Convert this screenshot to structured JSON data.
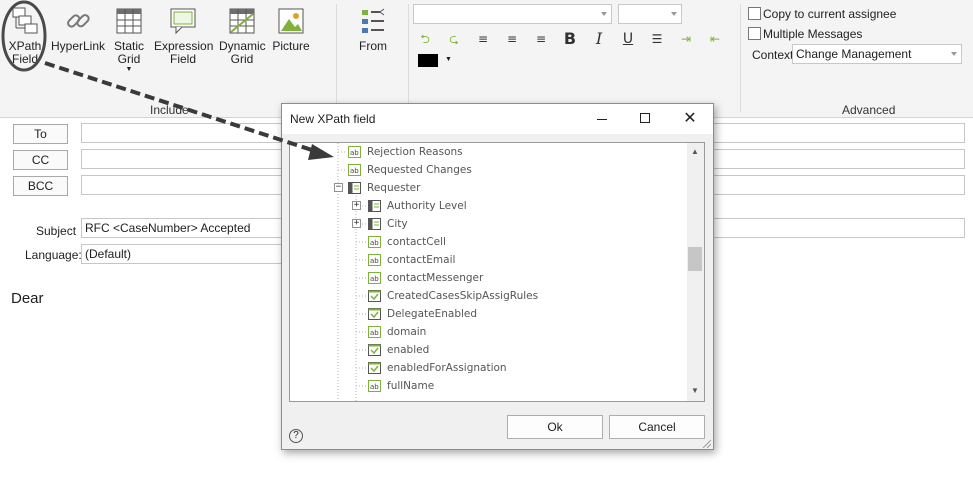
{
  "ribbon": {
    "insert_buttons": [
      {
        "label_line1": "XPath",
        "label_line2": "Field",
        "icon": "xpath-field-icon"
      },
      {
        "label_line1": "HyperLink",
        "label_line2": "",
        "icon": "hyperlink-icon"
      },
      {
        "label_line1": "Static",
        "label_line2": "Grid",
        "icon": "static-grid-icon"
      },
      {
        "label_line1": "Expression",
        "label_line2": "Field",
        "icon": "expression-field-icon"
      },
      {
        "label_line1": "Dynamic",
        "label_line2": "Grid",
        "icon": "dynamic-grid-icon"
      },
      {
        "label_line1": "Picture",
        "label_line2": "",
        "icon": "picture-icon"
      }
    ],
    "include_group_label": "Include",
    "from_label": "From",
    "font_combo_value": "",
    "size_combo_value": "",
    "font_color": "#000000",
    "advanced": {
      "copy_to_assignee_label": "Copy to current assignee",
      "copy_to_assignee_checked": false,
      "multiple_messages_label": "Multiple Messages",
      "multiple_messages_checked": false,
      "context_label": "Context",
      "context_value": "Change Management",
      "group_label": "Advanced"
    }
  },
  "email_form": {
    "to_label": "To",
    "cc_label": "CC",
    "bcc_label": "BCC",
    "to_value": "",
    "cc_value": "",
    "bcc_value": "",
    "subject_label": "Subject",
    "subject_value": "RFC <CaseNumber> Accepted",
    "language_label": "Language:",
    "language_value": "(Default)",
    "body_text": "Dear"
  },
  "dialog": {
    "title": "New XPath field",
    "tree_items": [
      {
        "label": "Rejection Reasons",
        "type": "text-attribute"
      },
      {
        "label": "Requested Changes",
        "type": "text-attribute"
      },
      {
        "label": "Requester",
        "type": "entity",
        "expanded": true
      },
      {
        "label": "Authority Level",
        "type": "entity",
        "expanded": false
      },
      {
        "label": "City",
        "type": "entity",
        "expanded": false
      },
      {
        "label": "contactCell",
        "type": "text-attribute"
      },
      {
        "label": "contactEmail",
        "type": "text-attribute"
      },
      {
        "label": "contactMessenger",
        "type": "text-attribute"
      },
      {
        "label": "CreatedCasesSkipAssigRules",
        "type": "boolean-attribute"
      },
      {
        "label": "DelegateEnabled",
        "type": "boolean-attribute"
      },
      {
        "label": "domain",
        "type": "text-attribute"
      },
      {
        "label": "enabled",
        "type": "boolean-attribute"
      },
      {
        "label": "enabledForAssignation",
        "type": "boolean-attribute"
      },
      {
        "label": "fullName",
        "type": "text-attribute"
      }
    ],
    "ok_label": "Ok",
    "cancel_label": "Cancel",
    "help_label": "?"
  },
  "colors": {
    "attribute_icon_green": "#7fb23a",
    "annotation_arrow": "#3a3a3a"
  }
}
